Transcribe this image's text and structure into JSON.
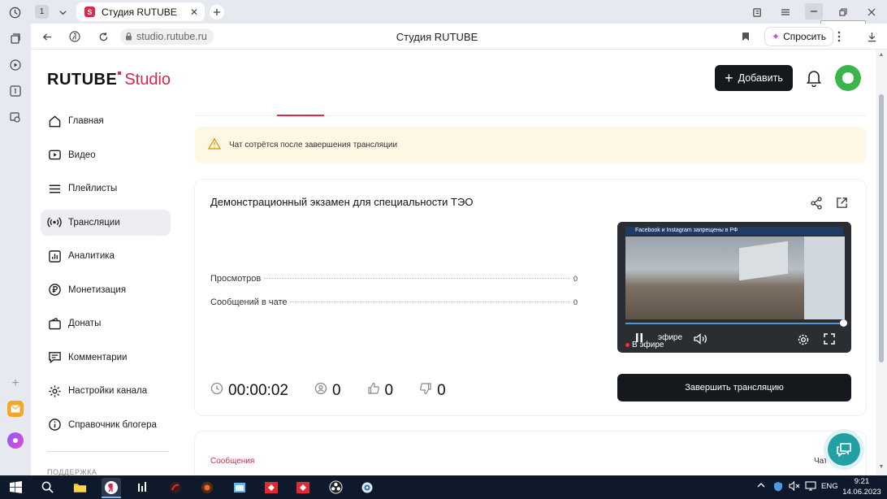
{
  "browser": {
    "tab_count": "1",
    "tab_title": "Студия RUTUBE",
    "tab_favicon_letter": "S",
    "url": "studio.rutube.ru",
    "page_title": "Студия RUTUBE",
    "ask_label": "Спросить",
    "minimize_tooltip": "Свернуть"
  },
  "header": {
    "logo_text": "RUTUBE",
    "logo_studio": "Studio",
    "add_label": "Добавить"
  },
  "sidebar": {
    "items": [
      {
        "label": "Главная",
        "icon": "home-icon"
      },
      {
        "label": "Видео",
        "icon": "video-icon"
      },
      {
        "label": "Плейлисты",
        "icon": "playlist-icon"
      },
      {
        "label": "Трансляции",
        "icon": "broadcast-icon",
        "active": true
      },
      {
        "label": "Аналитика",
        "icon": "analytics-icon"
      },
      {
        "label": "Монетизация",
        "icon": "ruble-icon"
      },
      {
        "label": "Донаты",
        "icon": "donate-icon"
      },
      {
        "label": "Комментарии",
        "icon": "comment-icon"
      },
      {
        "label": "Настройки канала",
        "icon": "gear-icon"
      },
      {
        "label": "Справочник блогера",
        "icon": "info-icon"
      }
    ],
    "section_label": "ПОДДЕРЖКА"
  },
  "alert": {
    "text": "Чат сотрётся после завершения трансляции"
  },
  "stream": {
    "title": "Демонстрационный экзамен для специальности ТЭО",
    "views_label": "Просмотров",
    "views_value": "0",
    "messages_label": "Сообщений в чате",
    "messages_value": "0",
    "duration": "00:00:02",
    "viewers": "0",
    "likes": "0",
    "dislikes": "0",
    "video_banner": "Facebook и Instagram запрещены в РФ",
    "live_label": "В эфире",
    "live_label_overlay": "эфире",
    "end_label": "Завершить трансляцию"
  },
  "messages": {
    "tab_label": "Сообщения",
    "chat_label": "Чат"
  },
  "taskbar": {
    "lang": "ENG",
    "time": "9:21",
    "date": "14.06.2023"
  },
  "colors": {
    "accent": "#e0254a",
    "dark_button": "#15191e",
    "alert_bg": "#fdf7e4",
    "avatar": "#3bb54a",
    "fab": "#23a0a4"
  }
}
